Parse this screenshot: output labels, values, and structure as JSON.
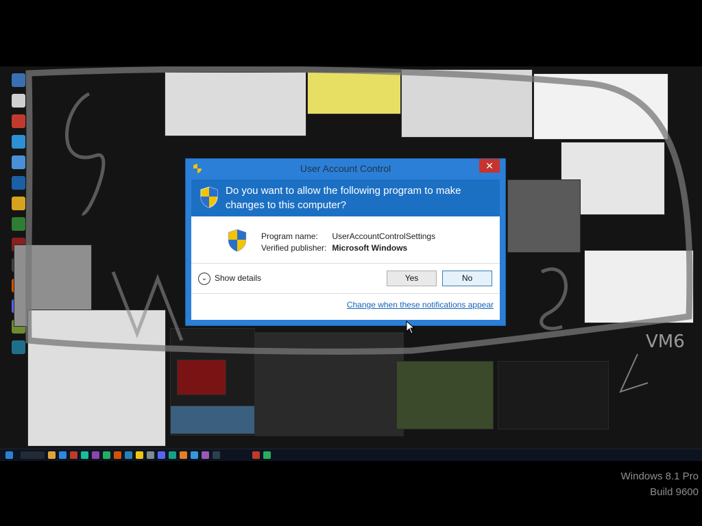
{
  "dialog": {
    "title": "User Account Control",
    "close_glyph": "✕",
    "question": "Do you want to allow the following program to make changes to this computer?",
    "program_label": "Program name:",
    "program_value": "UserAccountControlSettings",
    "publisher_label": "Verified publisher:",
    "publisher_value": "Microsoft Windows",
    "show_details": "Show details",
    "yes_label": "Yes",
    "no_label": "No",
    "change_link": "Change when these notifications appear"
  },
  "desktop": {
    "vm_label": "VM6"
  },
  "watermark": {
    "line1": "Windows 8.1 Pro",
    "line2": "Build 9600"
  },
  "colors": {
    "dialog_frame": "#2b7fd6",
    "dialog_header": "#1c70c4",
    "close_red": "#c7342e",
    "link": "#1664b9"
  },
  "icons": [
    "uac-shield-icon",
    "close-icon",
    "chevron-down-icon",
    "mouse-cursor-icon"
  ]
}
